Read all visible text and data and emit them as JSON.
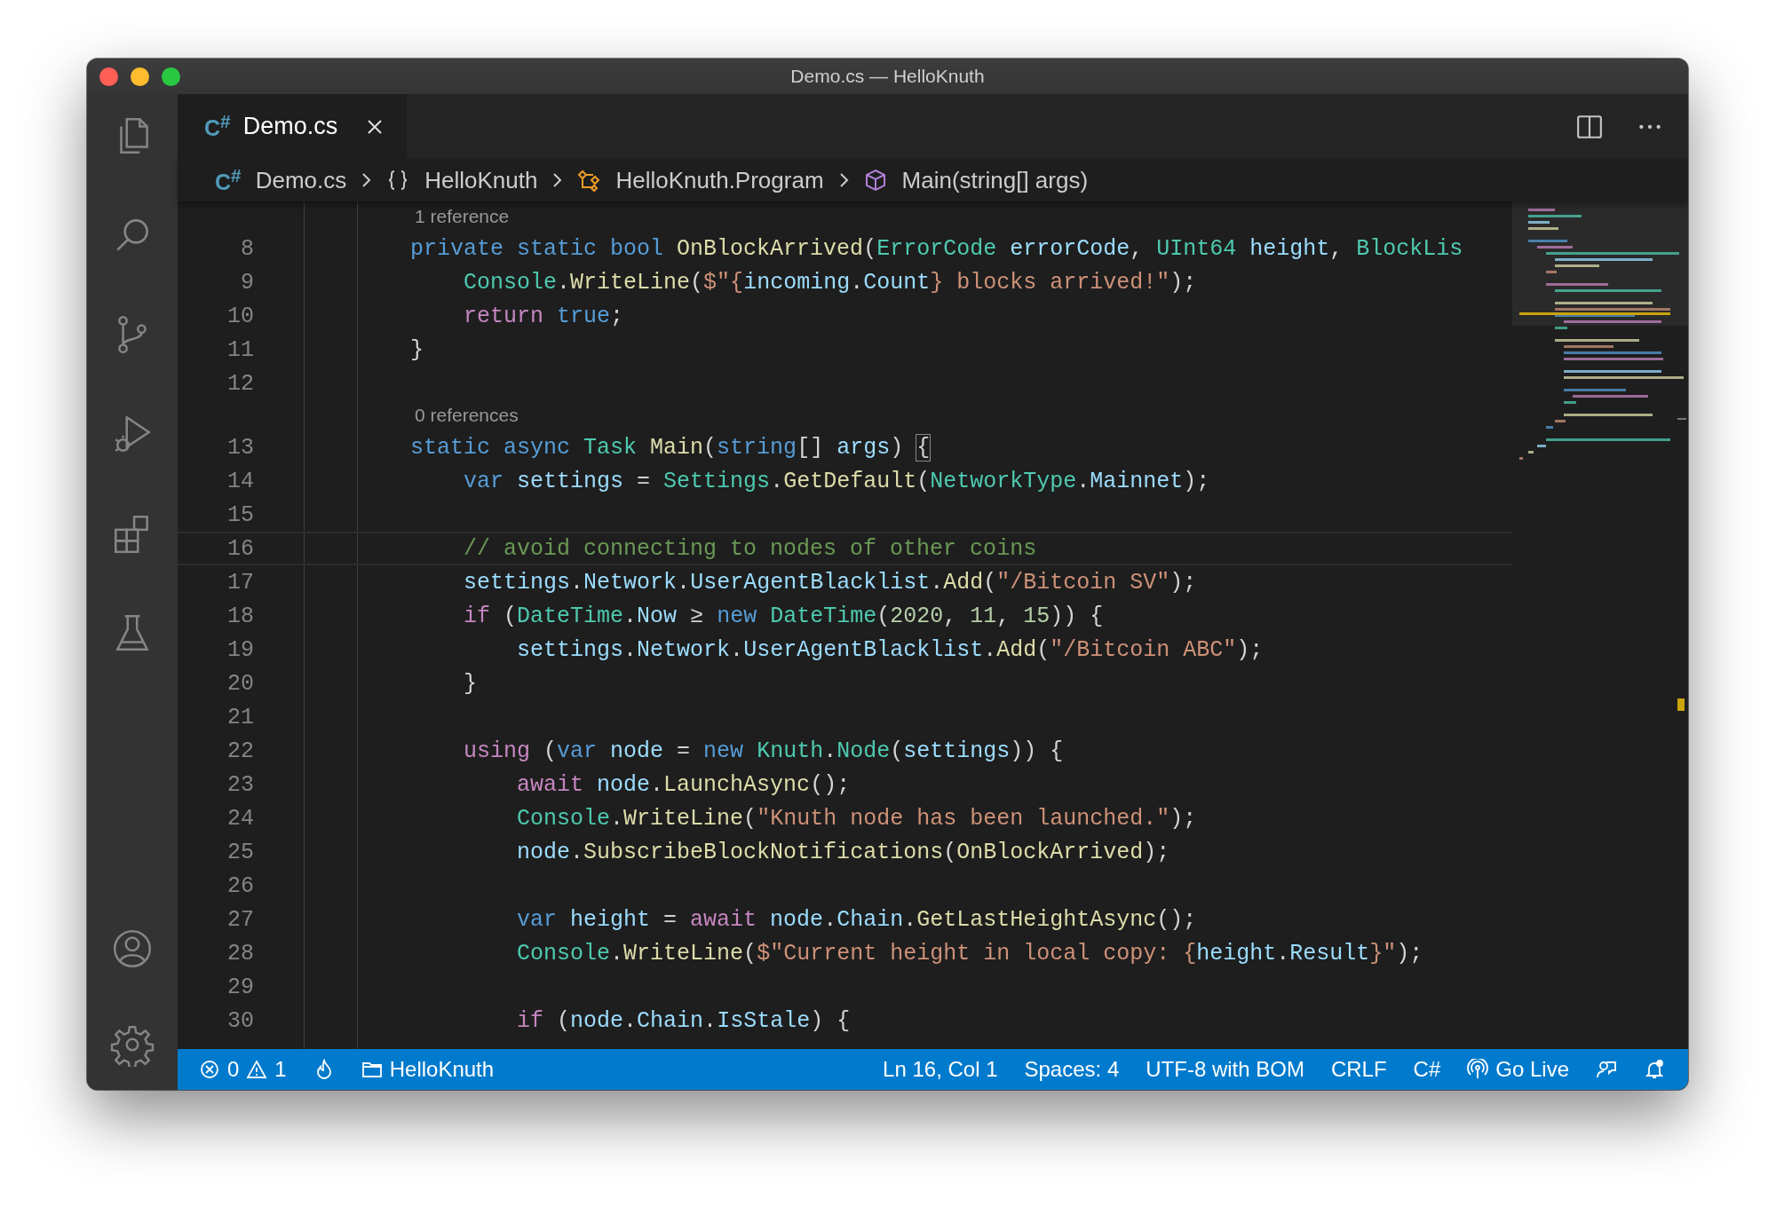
{
  "window": {
    "title": "Demo.cs — HelloKnuth"
  },
  "tabs": [
    {
      "label": "Demo.cs",
      "icon_text": "C$^{#}$",
      "selected": true
    }
  ],
  "breadcrumbs": [
    {
      "kind": "file",
      "label": "Demo.cs",
      "icon_text": "C$^{#}$"
    },
    {
      "kind": "namespace",
      "label": "HelloKnuth"
    },
    {
      "kind": "class",
      "label": "HelloKnuth.Program"
    },
    {
      "kind": "method",
      "label": "Main(string[] args)"
    }
  ],
  "editor": {
    "rows": [
      {
        "kind": "codelens",
        "text": "1 reference"
      },
      {
        "kind": "code",
        "number": "8",
        "current": false,
        "tokens": [
          {
            "kind": "kw",
            "s": "        private static bool "
          },
          {
            "kind": "fn",
            "s": "OnBlockArrived"
          },
          {
            "kind": "plain",
            "s": "("
          },
          {
            "kind": "type",
            "s": "ErrorCode "
          },
          {
            "kind": "var",
            "s": "errorCode"
          },
          {
            "kind": "plain",
            "s": ", "
          },
          {
            "kind": "type",
            "s": "UInt64 "
          },
          {
            "kind": "var",
            "s": "height"
          },
          {
            "kind": "plain",
            "s": ", "
          },
          {
            "kind": "type",
            "s": "BlockLis"
          }
        ]
      },
      {
        "kind": "code",
        "number": "9",
        "current": false,
        "tokens": [
          {
            "kind": "type",
            "s": "            Console"
          },
          {
            "kind": "plain",
            "s": "."
          },
          {
            "kind": "fn",
            "s": "WriteLine"
          },
          {
            "kind": "plain",
            "s": "("
          },
          {
            "kind": "str",
            "s": "$\"{"
          },
          {
            "kind": "var",
            "s": "incoming"
          },
          {
            "kind": "plain",
            "s": "."
          },
          {
            "kind": "var",
            "s": "Count"
          },
          {
            "kind": "str",
            "s": "} blocks arrived!\""
          },
          {
            "kind": "plain",
            "s": ");"
          }
        ]
      },
      {
        "kind": "code",
        "number": "10",
        "current": false,
        "tokens": [
          {
            "kind": "ctl",
            "s": "            return "
          },
          {
            "kind": "kw",
            "s": "true"
          },
          {
            "kind": "plain",
            "s": ";"
          }
        ]
      },
      {
        "kind": "code",
        "number": "11",
        "current": false,
        "tokens": [
          {
            "kind": "plain",
            "s": "        }"
          }
        ]
      },
      {
        "kind": "code",
        "number": "12",
        "current": false
      },
      {
        "kind": "codelens",
        "text": "0 references"
      },
      {
        "kind": "code",
        "number": "13",
        "current": false,
        "tokens": [
          {
            "kind": "kw",
            "s": "        static async "
          },
          {
            "kind": "type",
            "s": "Task "
          },
          {
            "kind": "fn",
            "s": "Main"
          },
          {
            "kind": "plain",
            "s": "("
          },
          {
            "kind": "kw",
            "s": "string"
          },
          {
            "kind": "plain",
            "s": "[] "
          },
          {
            "kind": "var",
            "s": "args"
          },
          {
            "kind": "plain",
            "s": ") "
          },
          {
            "kind": "match",
            "s": "{"
          }
        ]
      },
      {
        "kind": "code",
        "number": "14",
        "current": false,
        "tokens": [
          {
            "kind": "kw",
            "s": "            var "
          },
          {
            "kind": "var",
            "s": "settings"
          },
          {
            "kind": "plain",
            "s": " = "
          },
          {
            "kind": "type",
            "s": "Settings"
          },
          {
            "kind": "plain",
            "s": "."
          },
          {
            "kind": "fn",
            "s": "GetDefault"
          },
          {
            "kind": "plain",
            "s": "("
          },
          {
            "kind": "type",
            "s": "NetworkType"
          },
          {
            "kind": "plain",
            "s": "."
          },
          {
            "kind": "var",
            "s": "Mainnet"
          },
          {
            "kind": "plain",
            "s": ");"
          }
        ]
      },
      {
        "kind": "code",
        "number": "15",
        "current": false
      },
      {
        "kind": "code",
        "number": "16",
        "current": true,
        "tokens": [
          {
            "kind": "cmt",
            "s": "            // avoid connecting to nodes of other coins"
          }
        ]
      },
      {
        "kind": "code",
        "number": "17",
        "current": false,
        "tokens": [
          {
            "kind": "var",
            "s": "            settings"
          },
          {
            "kind": "plain",
            "s": "."
          },
          {
            "kind": "var",
            "s": "Network"
          },
          {
            "kind": "plain",
            "s": "."
          },
          {
            "kind": "var",
            "s": "UserAgentBlacklist"
          },
          {
            "kind": "plain",
            "s": "."
          },
          {
            "kind": "fn",
            "s": "Add"
          },
          {
            "kind": "plain",
            "s": "("
          },
          {
            "kind": "str",
            "s": "\"/Bitcoin SV\""
          },
          {
            "kind": "plain",
            "s": ");"
          }
        ]
      },
      {
        "kind": "code",
        "number": "18",
        "current": false,
        "tokens": [
          {
            "kind": "ctl",
            "s": "            if"
          },
          {
            "kind": "plain",
            "s": " ("
          },
          {
            "kind": "type",
            "s": "DateTime"
          },
          {
            "kind": "plain",
            "s": "."
          },
          {
            "kind": "var",
            "s": "Now"
          },
          {
            "kind": "plain",
            "s": " ≥ "
          },
          {
            "kind": "kw",
            "s": "new "
          },
          {
            "kind": "type",
            "s": "DateTime"
          },
          {
            "kind": "plain",
            "s": "("
          },
          {
            "kind": "num",
            "s": "2020"
          },
          {
            "kind": "plain",
            "s": ", "
          },
          {
            "kind": "num",
            "s": "11"
          },
          {
            "kind": "plain",
            "s": ", "
          },
          {
            "kind": "num",
            "s": "15"
          },
          {
            "kind": "plain",
            "s": ")) {"
          }
        ]
      },
      {
        "kind": "code",
        "number": "19",
        "current": false,
        "tokens": [
          {
            "kind": "var",
            "s": "                settings"
          },
          {
            "kind": "plain",
            "s": "."
          },
          {
            "kind": "var",
            "s": "Network"
          },
          {
            "kind": "plain",
            "s": "."
          },
          {
            "kind": "var",
            "s": "UserAgentBlacklist"
          },
          {
            "kind": "plain",
            "s": "."
          },
          {
            "kind": "fn",
            "s": "Add"
          },
          {
            "kind": "plain",
            "s": "("
          },
          {
            "kind": "str",
            "s": "\"/Bitcoin ABC\""
          },
          {
            "kind": "plain",
            "s": ");"
          }
        ]
      },
      {
        "kind": "code",
        "number": "20",
        "current": false,
        "tokens": [
          {
            "kind": "plain",
            "s": "            }"
          }
        ]
      },
      {
        "kind": "code",
        "number": "21",
        "current": false
      },
      {
        "kind": "code",
        "number": "22",
        "current": false,
        "tokens": [
          {
            "kind": "ctl",
            "s": "            using"
          },
          {
            "kind": "plain",
            "s": " ("
          },
          {
            "kind": "kw",
            "s": "var "
          },
          {
            "kind": "var",
            "s": "node"
          },
          {
            "kind": "plain",
            "s": " = "
          },
          {
            "kind": "kw",
            "s": "new "
          },
          {
            "kind": "type",
            "s": "Knuth"
          },
          {
            "kind": "plain",
            "s": "."
          },
          {
            "kind": "type",
            "s": "Node"
          },
          {
            "kind": "plain",
            "s": "("
          },
          {
            "kind": "var",
            "s": "settings"
          },
          {
            "kind": "plain",
            "s": ")) {"
          }
        ]
      },
      {
        "kind": "code",
        "number": "23",
        "current": false,
        "tokens": [
          {
            "kind": "ctl",
            "s": "                await "
          },
          {
            "kind": "var",
            "s": "node"
          },
          {
            "kind": "plain",
            "s": "."
          },
          {
            "kind": "fn",
            "s": "LaunchAsync"
          },
          {
            "kind": "plain",
            "s": "();"
          }
        ]
      },
      {
        "kind": "code",
        "number": "24",
        "current": false,
        "tokens": [
          {
            "kind": "type",
            "s": "                Console"
          },
          {
            "kind": "plain",
            "s": "."
          },
          {
            "kind": "fn",
            "s": "WriteLine"
          },
          {
            "kind": "plain",
            "s": "("
          },
          {
            "kind": "str",
            "s": "\"Knuth node has been launched.\""
          },
          {
            "kind": "plain",
            "s": ");"
          }
        ]
      },
      {
        "kind": "code",
        "number": "25",
        "current": false,
        "tokens": [
          {
            "kind": "var",
            "s": "                node"
          },
          {
            "kind": "plain",
            "s": "."
          },
          {
            "kind": "fn",
            "s": "SubscribeBlockNotifications"
          },
          {
            "kind": "plain",
            "s": "("
          },
          {
            "kind": "fn",
            "s": "OnBlockArrived"
          },
          {
            "kind": "plain",
            "s": ");"
          }
        ]
      },
      {
        "kind": "code",
        "number": "26",
        "current": false
      },
      {
        "kind": "code",
        "number": "27",
        "current": false,
        "tokens": [
          {
            "kind": "kw",
            "s": "                var "
          },
          {
            "kind": "var",
            "s": "height"
          },
          {
            "kind": "plain",
            "s": " = "
          },
          {
            "kind": "ctl",
            "s": "await "
          },
          {
            "kind": "var",
            "s": "node"
          },
          {
            "kind": "plain",
            "s": "."
          },
          {
            "kind": "var",
            "s": "Chain"
          },
          {
            "kind": "plain",
            "s": "."
          },
          {
            "kind": "fn",
            "s": "GetLastHeightAsync"
          },
          {
            "kind": "plain",
            "s": "();"
          }
        ]
      },
      {
        "kind": "code",
        "number": "28",
        "current": false,
        "tokens": [
          {
            "kind": "type",
            "s": "                Console"
          },
          {
            "kind": "plain",
            "s": "."
          },
          {
            "kind": "fn",
            "s": "WriteLine"
          },
          {
            "kind": "plain",
            "s": "("
          },
          {
            "kind": "str",
            "s": "$\"Current height in local copy: {"
          },
          {
            "kind": "var",
            "s": "height"
          },
          {
            "kind": "plain",
            "s": "."
          },
          {
            "kind": "var",
            "s": "Result"
          },
          {
            "kind": "str",
            "s": "}\""
          },
          {
            "kind": "plain",
            "s": ");"
          }
        ]
      },
      {
        "kind": "code",
        "number": "29",
        "current": false
      },
      {
        "kind": "code",
        "number": "30",
        "current": false,
        "tokens": [
          {
            "kind": "ctl",
            "s": "                if"
          },
          {
            "kind": "plain",
            "s": " ("
          },
          {
            "kind": "var",
            "s": "node"
          },
          {
            "kind": "plain",
            "s": "."
          },
          {
            "kind": "var",
            "s": "Chain"
          },
          {
            "kind": "plain",
            "s": "."
          },
          {
            "kind": "var",
            "s": "IsStale"
          },
          {
            "kind": "plain",
            "s": ") {"
          }
        ]
      }
    ]
  },
  "status_bar": {
    "errors": "0",
    "warnings": "1",
    "folder": "HelloKnuth",
    "position": "Ln 16, Col 1",
    "spaces": "Spaces: 4",
    "encoding": "UTF-8 with BOM",
    "eol": "CRLF",
    "language": "C#",
    "live": "Go Live"
  }
}
